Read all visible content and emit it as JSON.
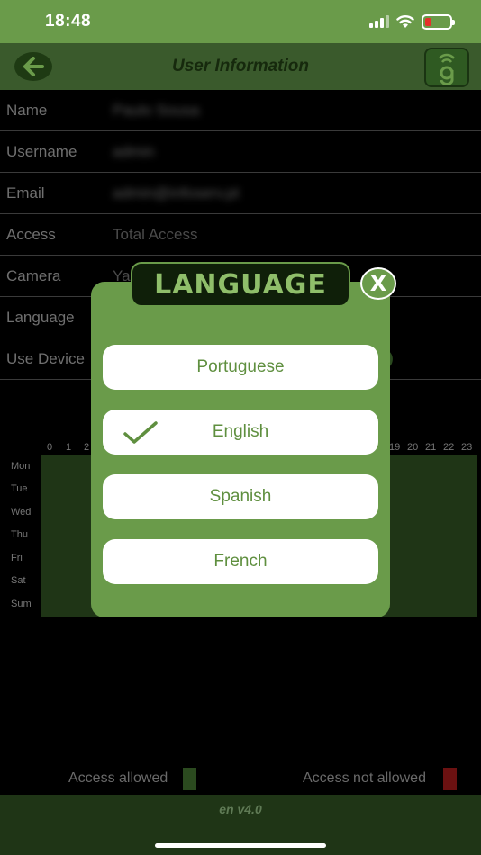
{
  "status_bar": {
    "time": "18:48"
  },
  "header": {
    "title": "User Information"
  },
  "info_rows": [
    {
      "label": "Name",
      "value": "Paulo Sousa"
    },
    {
      "label": "Username",
      "value": "admin"
    },
    {
      "label": "Email",
      "value": "admin@infoserv.pt"
    },
    {
      "label": "Access",
      "value": "Total Access"
    },
    {
      "label": "Camera",
      "value": "Ya"
    },
    {
      "label": "Language",
      "value": ""
    },
    {
      "label": "Use Device",
      "value": ""
    }
  ],
  "schedule": {
    "hours_left": [
      "0",
      "1",
      "2"
    ],
    "hours_right": [
      "19",
      "20",
      "21",
      "22",
      "23"
    ],
    "days": [
      "Mon",
      "Tue",
      "Wed",
      "Thu",
      "Fri",
      "Sat",
      "Sum"
    ]
  },
  "legend": {
    "allowed": "Access allowed",
    "not_allowed": "Access not allowed",
    "allowed_color": "#2b4a1f",
    "not_allowed_color": "#6b1111"
  },
  "footer": {
    "version": "en v4.0"
  },
  "dialog": {
    "title": "LANGUAGE",
    "close": "X",
    "options": [
      "Portuguese",
      "English",
      "Spanish",
      "French"
    ],
    "selected": "English"
  },
  "colors": {
    "accent": "#6a9b4a",
    "dark_green": "#1f3516"
  }
}
